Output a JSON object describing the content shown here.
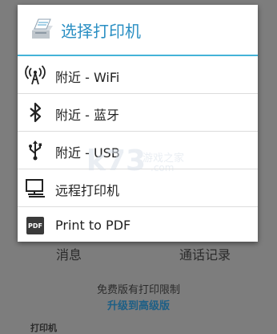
{
  "dialog": {
    "title": "选择打印机",
    "items": [
      {
        "label": "附近 - WiFi",
        "icon": "wifi-antenna-icon"
      },
      {
        "label": "附近 - 蓝牙",
        "icon": "bluetooth-icon"
      },
      {
        "label": "附近 - USB",
        "icon": "usb-icon"
      },
      {
        "label": "远程打印机",
        "icon": "computer-icon"
      },
      {
        "label": "Print to PDF",
        "icon": "pdf-icon",
        "icon_text": "PDF"
      }
    ]
  },
  "background": {
    "messages": "消息",
    "call_log": "通话记录",
    "free_notice": "免费版有打印限制",
    "upgrade_link": "升级到高级版",
    "cut_text": "打印机"
  },
  "watermark": {
    "brand": "k73",
    "text": "游戏之家",
    "domain": ".com"
  },
  "colors": {
    "accent": "#45b3d8",
    "title": "#2a8fc3",
    "overlay": "#7d7d7d"
  }
}
